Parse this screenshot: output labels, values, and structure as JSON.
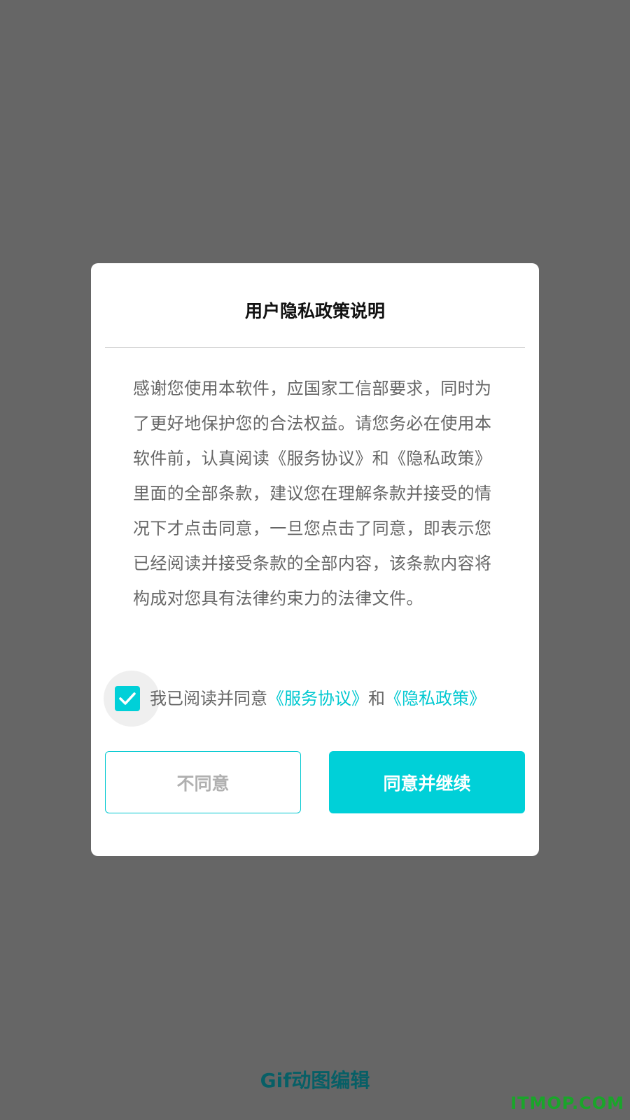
{
  "dialog": {
    "title": "用户隐私政策说明",
    "body": "感谢您使用本软件，应国家工信部要求，同时为了更好地保护您的合法权益。请您务必在使用本软件前，认真阅读《服务协议》和《隐私政策》里面的全部条款，建议您在理解条款并接受的情况下才点击同意，一旦您点击了同意，即表示您已经阅读并接受条款的全部内容，该条款内容将构成对您具有法律约束力的法律文件。",
    "agreement": {
      "checked": true,
      "prefix": "我已阅读并同意",
      "service_link": "《服务协议》",
      "conjunction": "和",
      "privacy_link": "《隐私政策》"
    },
    "disagree_label": "不同意",
    "agree_label": "同意并继续"
  },
  "footer": {
    "app_name": "Gif动图编辑",
    "watermark": "ITMOP.COM"
  },
  "colors": {
    "overlay": "#666666",
    "accent": "#00d0d8",
    "link": "#00c8d0",
    "app_name": "#075f66",
    "watermark": "#1aa52a"
  }
}
